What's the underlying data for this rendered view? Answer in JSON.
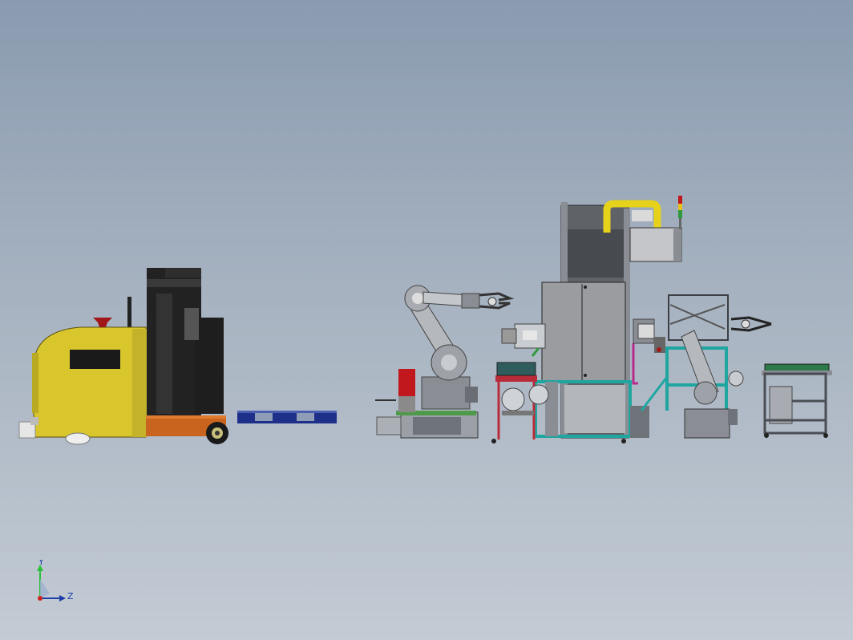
{
  "viewport": {
    "background_top": "#8a9bb0",
    "background_bottom": "#c3cbd4"
  },
  "triad": {
    "y_label": "Y",
    "z_label": "Z",
    "y_color": "#2cbf3a",
    "z_color": "#1f3fa8",
    "origin_color": "#d02020"
  },
  "model": {
    "agv_forklift": {
      "body_color": "#d8c62c",
      "mast_color": "#222222",
      "fork_color": "#c8641e",
      "pallet_color": "#1e2f8a"
    },
    "robot_cell_left": {
      "robot_color": "#a8acb2",
      "base_color": "#7a7e84",
      "controller_color": "#c0181c"
    },
    "central_station": {
      "tower_color": "#5f6368",
      "cabinet_color": "#9a9ca0",
      "duct_color": "#e6d21a",
      "frame_color": "#1fa6a0",
      "table_color": "#b82c3a"
    },
    "robot_cell_right": {
      "robot_color": "#a8acb2",
      "frame_color": "#1fa6a0"
    },
    "conveyor_stand": {
      "belt_color": "#2c7a4a",
      "frame_color": "#4a4e54"
    }
  }
}
